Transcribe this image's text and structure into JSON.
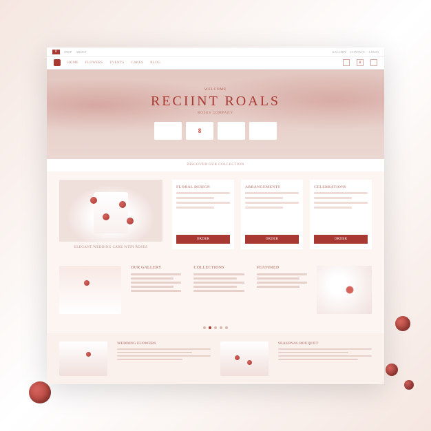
{
  "topbar": {
    "tag": "P",
    "links": [
      "SHOP",
      "ABOUT",
      "GALLERY",
      "CONTACT",
      "LOGIN"
    ]
  },
  "nav": {
    "items": [
      "HOME",
      "FLOWERS",
      "EVENTS",
      "CAKES",
      "BLOG"
    ],
    "icons": [
      "search",
      "cart",
      "user"
    ],
    "badge": "8"
  },
  "hero": {
    "eyebrow": "WELCOME",
    "title": "RECIINT ROALS",
    "subtitle": "ROSES COMPANY",
    "cards": [
      "",
      "8",
      "",
      ""
    ]
  },
  "band": "DISCOVER OUR COLLECTION",
  "cake_caption": "ELEGANT WEDDING CAKE WITH ROSES",
  "cols": [
    {
      "title": "FLORAL DESIGN",
      "btn": "ORDER"
    },
    {
      "title": "ARRANGEMENTS",
      "btn": "ORDER"
    },
    {
      "title": "CELEBRATIONS",
      "btn": "ORDER"
    }
  ],
  "lower": {
    "heading1": "OUR GALLERY",
    "heading2": "COLLECTIONS",
    "heading3": "FEATURED"
  },
  "foot": [
    {
      "title": "WEDDING FLOWERS"
    },
    {
      "title": "SEASONAL BOUQUET"
    }
  ]
}
